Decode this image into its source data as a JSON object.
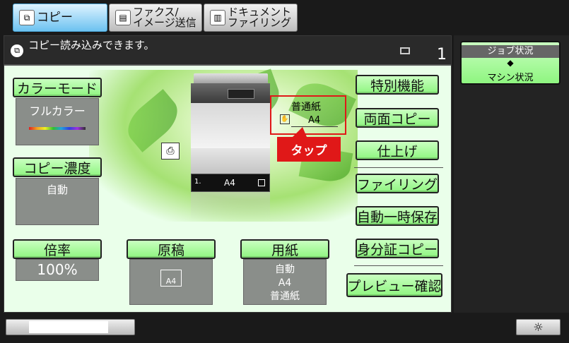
{
  "tabs": [
    {
      "label": "コピー",
      "icon": "copy-icon"
    },
    {
      "label_line1": "ファクス/",
      "label_line2": "イメージ送信",
      "icon": "fax-icon"
    },
    {
      "label_line1": "ドキュメント",
      "label_line2": "ファイリング",
      "icon": "filing-icon"
    }
  ],
  "message": {
    "text": "コピー読み込みできます。",
    "copies": "1"
  },
  "color_mode": {
    "label": "カラーモード",
    "value": "フルカラー"
  },
  "density": {
    "label": "コピー濃度",
    "value": "自動"
  },
  "ratio": {
    "label": "倍率",
    "value": "100%"
  },
  "original": {
    "label": "原稿",
    "value": "A4"
  },
  "paper": {
    "label": "用紙",
    "value1": "自動",
    "value2": "A4",
    "value3": "普通紙"
  },
  "machine": {
    "tray_label": "普通紙",
    "tray_size": "A4",
    "cassette_size": "A4",
    "cassette_no": "1."
  },
  "tap_label": "タップ",
  "right_buttons": [
    "特別機能",
    "両面コピー",
    "仕上げ",
    "ファイリング",
    "自動一時保存",
    "身分証コピー",
    "プレビュー確認"
  ],
  "job_status": {
    "top": "ジョブ状況",
    "arrows": "◆",
    "bottom": "マシン状況"
  },
  "colors": {
    "accent_green": "#8ff580",
    "highlight_red": "#e01818",
    "active_tab": "#6cc2f0"
  },
  "brightness_icon": "☼"
}
